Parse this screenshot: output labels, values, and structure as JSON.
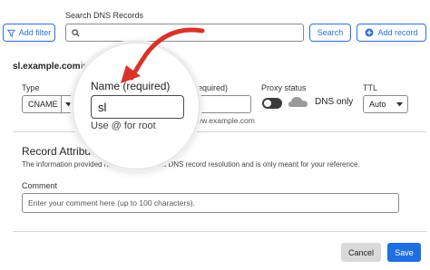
{
  "toolbar": {
    "add_filter_label": "Add filter",
    "search_label": "Search DNS Records",
    "search_placeholder": "",
    "search_button": "Search",
    "add_record_label": "Add record"
  },
  "form": {
    "site_name": "sl.example.com",
    "site_suffix": "is",
    "type_label": "Type",
    "type_value": "CNAME",
    "name_label": "Name (required)",
    "name_value": "sl",
    "name_hint": "Use @ for root",
    "target_label": "(required)",
    "target_hint": "www.example.com",
    "proxy_label": "Proxy status",
    "proxy_value": "DNS only",
    "ttl_label": "TTL",
    "ttl_value": "Auto"
  },
  "record_attributes": {
    "title": "Record Attribute",
    "description": "The information provided here will not impact DNS record resolution and is only meant for your reference.",
    "comment_label": "Comment",
    "comment_placeholder": "Enter your comment here (up to 100 characters)."
  },
  "actions": {
    "cancel": "Cancel",
    "save": "Save"
  },
  "colors": {
    "accent": "#1f6fe0",
    "annotation_red": "#d8342a"
  }
}
